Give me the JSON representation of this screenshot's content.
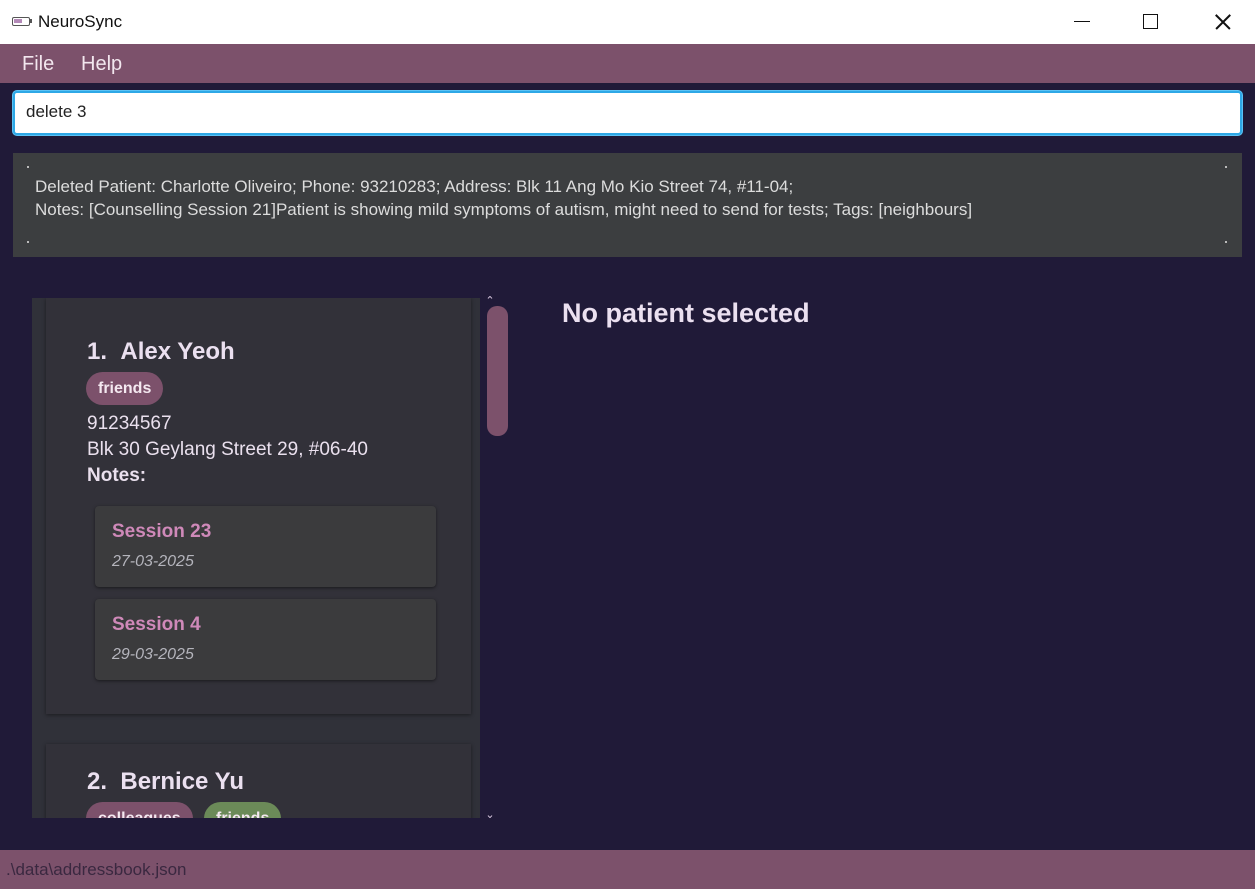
{
  "window": {
    "title": "NeuroSync"
  },
  "menu": {
    "items": [
      "File",
      "Help"
    ]
  },
  "command": {
    "value": "delete 3"
  },
  "result": {
    "line1": "Deleted Patient: Charlotte Oliveiro; Phone: 93210283; Address: Blk 11 Ang Mo Kio Street 74, #11-04;",
    "line2": "Notes: [Counselling Session 21]Patient is showing mild symptoms of autism, might need to send for tests; Tags: [neighbours]"
  },
  "patients": [
    {
      "index": "1.",
      "name": "Alex Yeoh",
      "tags": [
        "friends"
      ],
      "phone": "91234567",
      "address": "Blk 30 Geylang Street 29, #06-40",
      "notes_label": "Notes:",
      "sessions": [
        {
          "title": "Session 23",
          "date": "27-03-2025"
        },
        {
          "title": "Session 4",
          "date": "29-03-2025"
        }
      ]
    },
    {
      "index": "2.",
      "name": "Bernice Yu",
      "tags": [
        "colleagues",
        "friends"
      ]
    }
  ],
  "detail": {
    "heading": "No patient selected"
  },
  "status": {
    "path": ".\\data\\addressbook.json"
  },
  "colors": {
    "background": "#201a38",
    "accent": "#7c516b",
    "card": "#323139",
    "session_title": "#cf89b9",
    "tag_green": "#6b8a58",
    "command_border": "#2ea8e6"
  },
  "icons": [
    "app-icon",
    "minimize-icon",
    "maximize-icon",
    "close-icon",
    "scroll-up-arrow-icon",
    "scroll-down-arrow-icon"
  ]
}
